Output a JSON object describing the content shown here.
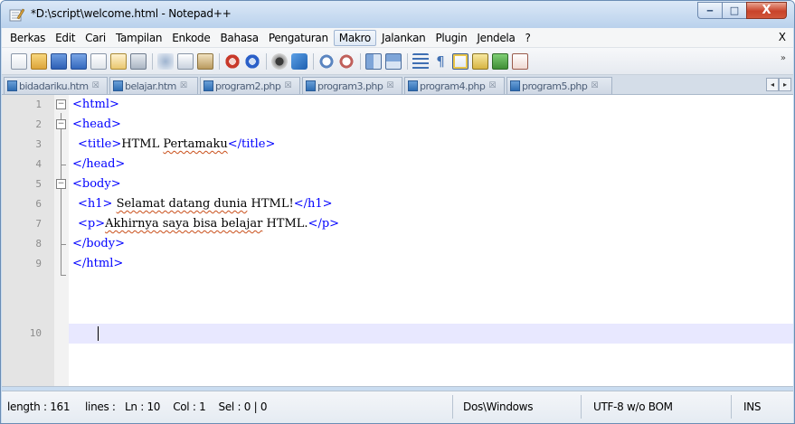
{
  "window": {
    "title": "*D:\\script\\welcome.html - Notepad++",
    "min_glyph": "‒",
    "max_glyph": "□",
    "close_glyph": "X"
  },
  "menu": {
    "items": [
      "Berkas",
      "Edit",
      "Cari",
      "Tampilan",
      "Enkode",
      "Bahasa",
      "Pengaturan",
      "Makro",
      "Jalankan",
      "Plugin",
      "Jendela",
      "?"
    ],
    "active": "Makro",
    "close_glyph": "X"
  },
  "toolbar": {
    "icons": [
      "new-file-icon",
      "open-file-icon",
      "save-icon",
      "save-all-icon",
      "close-icon",
      "close-all-icon",
      "print-icon",
      "cut-icon",
      "copy-icon",
      "paste-icon",
      "undo-icon",
      "redo-icon",
      "find-icon",
      "replace-icon",
      "zoom-in-icon",
      "zoom-out-icon",
      "sync-vertical-icon",
      "sync-horizontal-icon",
      "word-wrap-icon",
      "show-all-chars-icon",
      "indent-guide-icon",
      "user-language-icon",
      "doc-map-icon",
      "function-list-icon"
    ],
    "more_glyph": "»"
  },
  "tabs": [
    {
      "label": "bidadariku.htm",
      "close": "☒"
    },
    {
      "label": "belajar.htm",
      "close": "☒"
    },
    {
      "label": "program2.php",
      "close": "☒"
    },
    {
      "label": "program3.php",
      "close": "☒"
    },
    {
      "label": "program4.php",
      "close": "☒"
    },
    {
      "label": "program5.php",
      "close": "☒"
    }
  ],
  "tab_scroll": {
    "left": "◂",
    "right": "▸"
  },
  "editor": {
    "lines": [
      {
        "num": "1",
        "t1": "<html>"
      },
      {
        "num": "2",
        "t1": "<head>"
      },
      {
        "num": "3",
        "t1": "<title>",
        "t2": "HTML ",
        "t3": "Pertamaku",
        "t4": "</title>"
      },
      {
        "num": "4",
        "t1": "</head>"
      },
      {
        "num": "5",
        "t1": "<body>"
      },
      {
        "num": "6",
        "t1": "<h1>",
        "t2": " ",
        "t3": "Selamat datang dunia",
        "t4": " HTML!",
        "t5": "</h1>"
      },
      {
        "num": "7",
        "t1": "<p>",
        "t3": "Akhirnya saya bisa belajar",
        "t4": " HTML.",
        "t5": "</p>"
      },
      {
        "num": "8",
        "t1": "</body>"
      },
      {
        "num": "9",
        "t1": "</html>"
      },
      {
        "num": "10"
      }
    ],
    "fold_minus": "−",
    "colors": {
      "tag": "#0000ff",
      "current_line": "#e8e8ff"
    }
  },
  "status": {
    "length": "length : 161",
    "lines": "lines : ",
    "position": "Ln : 10    Col : 1    Sel : 0 | 0",
    "eol": "Dos\\Windows",
    "encoding": "UTF-8 w/o BOM",
    "mode": "INS"
  }
}
